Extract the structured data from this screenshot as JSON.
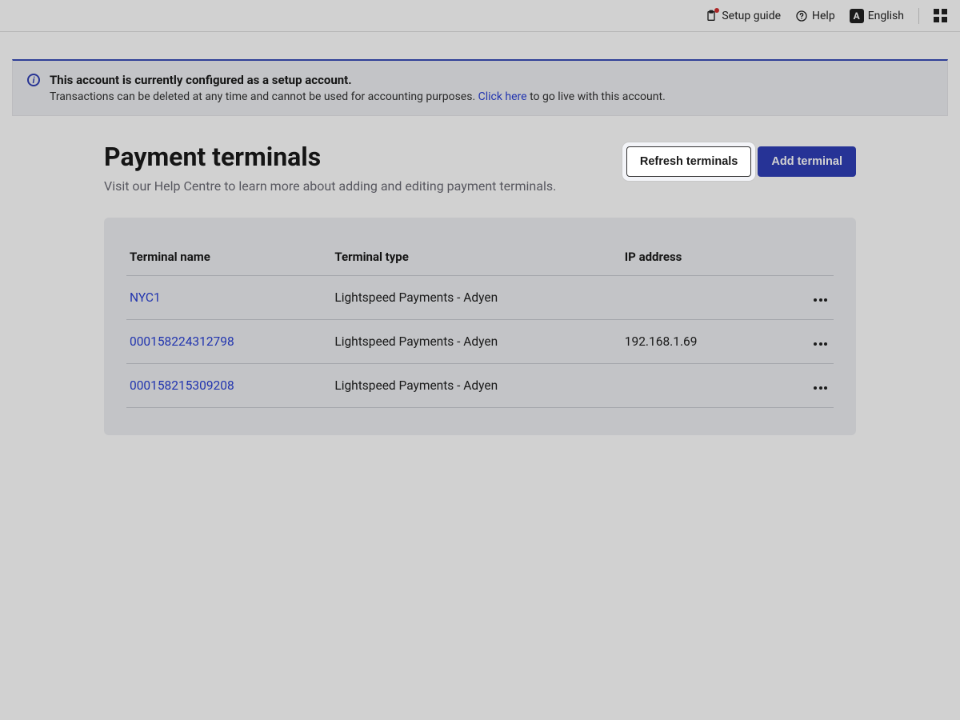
{
  "topbar": {
    "setup_guide": "Setup guide",
    "help": "Help",
    "language": "English",
    "language_badge": "A"
  },
  "alert": {
    "title": "This account is currently configured as a setup account.",
    "body_prefix": "Transactions can be deleted at any time and cannot be used for accounting purposes. ",
    "link_text": "Click here",
    "body_suffix": " to go live with this account."
  },
  "page": {
    "title": "Payment terminals",
    "subtitle": "Visit our Help Centre to learn more about adding and editing payment terminals.",
    "refresh_label": "Refresh terminals",
    "add_label": "Add terminal"
  },
  "table": {
    "headers": {
      "name": "Terminal name",
      "type": "Terminal type",
      "ip": "IP address"
    },
    "rows": [
      {
        "name": "NYC1",
        "type": "Lightspeed Payments - Adyen",
        "ip": ""
      },
      {
        "name": "000158224312798",
        "type": "Lightspeed Payments - Adyen",
        "ip": "192.168.1.69"
      },
      {
        "name": "000158215309208",
        "type": "Lightspeed Payments - Adyen",
        "ip": ""
      }
    ]
  }
}
